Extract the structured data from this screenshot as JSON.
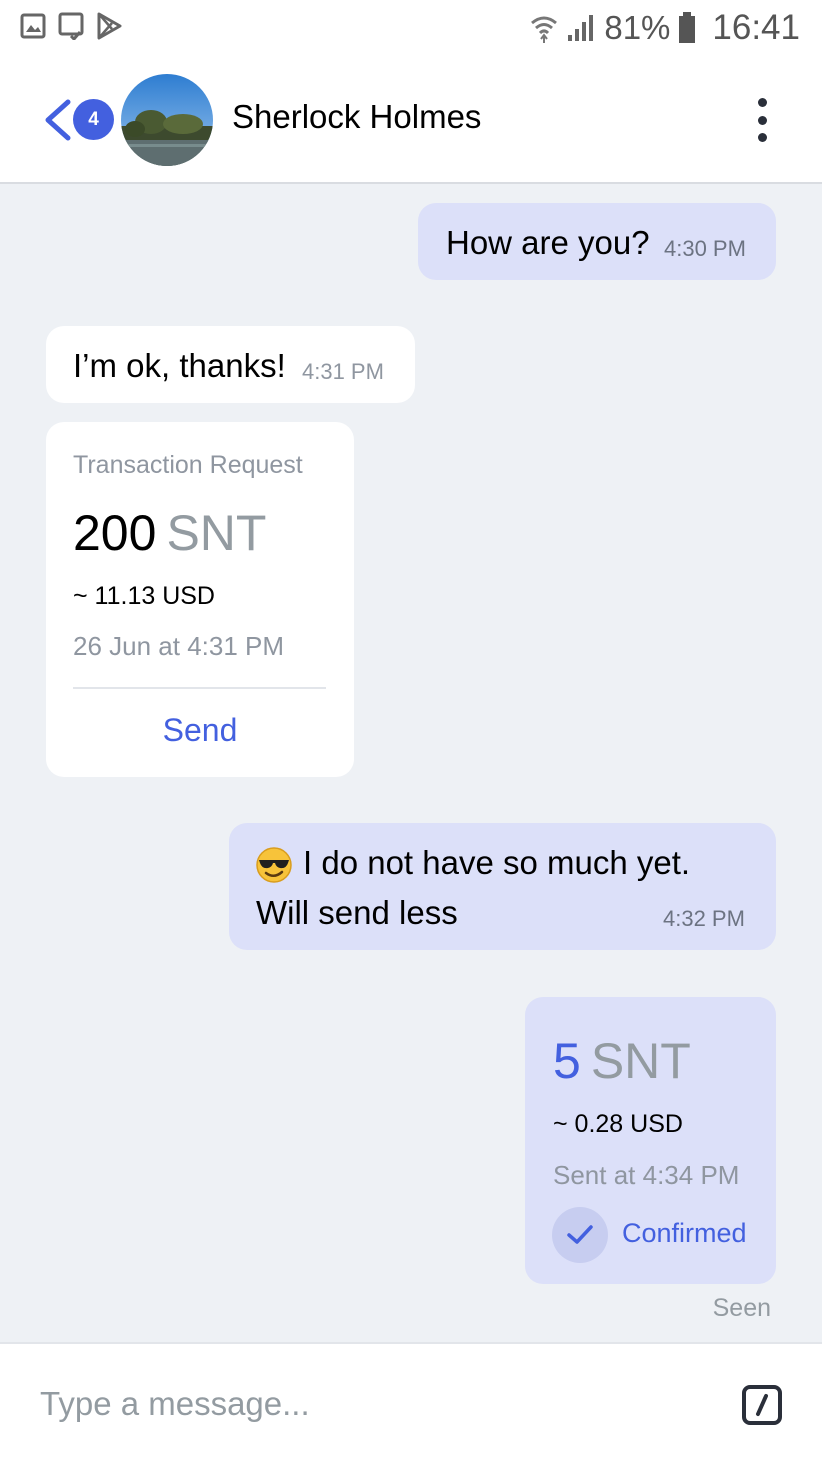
{
  "status_bar": {
    "icons": [
      "gallery-icon",
      "tablet-check-icon",
      "play-store-icon",
      "wifi-icon",
      "signal-icon",
      "battery-icon"
    ],
    "battery": "81%",
    "time": "16:41"
  },
  "header": {
    "unread_count": "4",
    "contact_name": "Sherlock Holmes"
  },
  "messages": [
    {
      "direction": "outgoing",
      "text": "How are you?",
      "time": "4:30 PM"
    },
    {
      "direction": "incoming",
      "text": "I’m ok, thanks!",
      "time": "4:31 PM"
    },
    {
      "direction": "incoming",
      "type": "transaction_request",
      "label": "Transaction Request",
      "amount": "200",
      "unit": "SNT",
      "fiat": "~ 11.13 USD",
      "date": "26 Jun at 4:31 PM",
      "action": "Send"
    },
    {
      "direction": "outgoing",
      "emoji": "sunglasses-emoji",
      "line1": "I do not have so much yet.",
      "line2": "Will send less",
      "time": "4:32 PM"
    },
    {
      "direction": "outgoing",
      "type": "transaction_sent",
      "amount": "5",
      "unit": "SNT",
      "fiat": "~ 0.28 USD",
      "sent": "Sent at 4:34 PM",
      "status": "Confirmed"
    }
  ],
  "seen_label": "Seen",
  "input": {
    "placeholder": "Type a message...",
    "value": ""
  },
  "colors": {
    "accent": "#4360df",
    "outgoing_bubble": "#dce0f9",
    "chat_background": "#eef1f5",
    "muted_text": "#939ba1"
  }
}
